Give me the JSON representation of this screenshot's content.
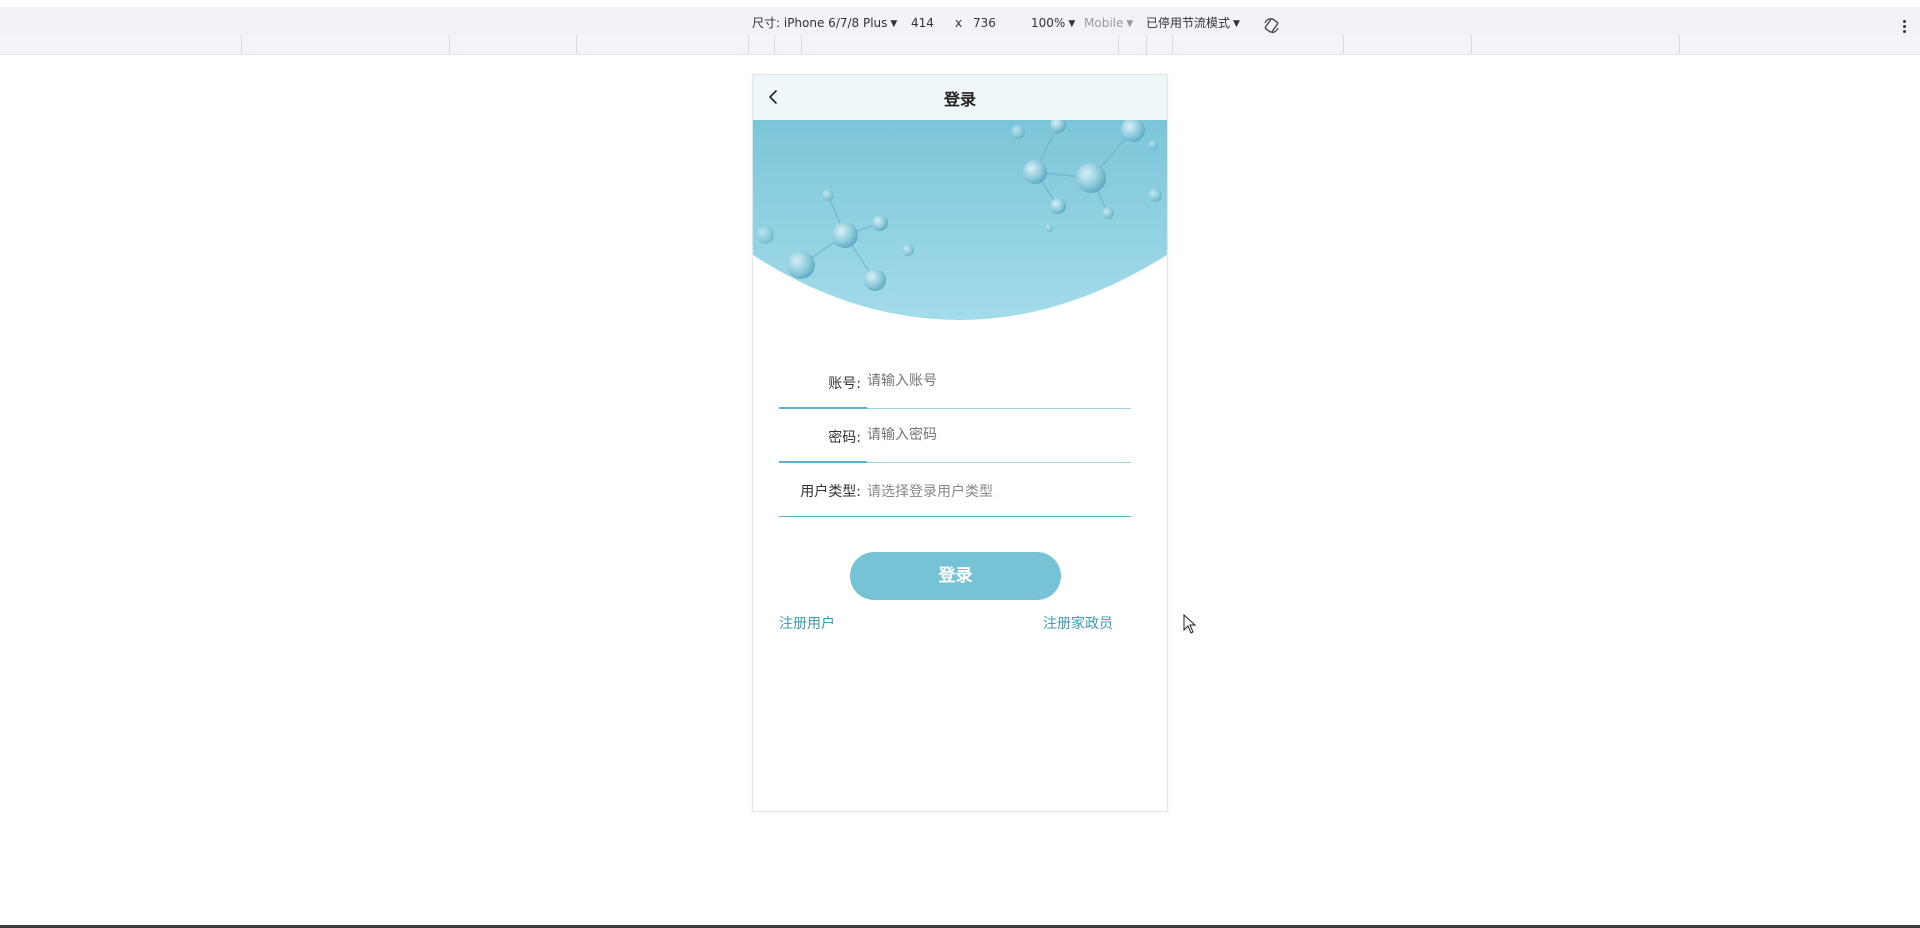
{
  "devtools": {
    "device_label": "尺寸: iPhone 6/7/8 Plus",
    "width": "414",
    "times": "x",
    "height": "736",
    "zoom": "100%",
    "mode": "Mobile",
    "throttle": "已停用节流模式"
  },
  "navbar": {
    "title": "登录"
  },
  "form": {
    "account": {
      "label": "账号:",
      "placeholder": "请输入账号"
    },
    "password": {
      "label": "密码:",
      "placeholder": "请输入密码"
    },
    "user_type": {
      "label": "用户类型:",
      "placeholder": "请选择登录用户类型"
    }
  },
  "login_button": "登录",
  "links": {
    "register_user": "注册用户",
    "register_housekeeper": "注册家政员"
  },
  "colors": {
    "accent": "#76c3d6",
    "link": "#3b9bb3",
    "banner_top": "#7cc5d9",
    "banner_bottom": "#a3dcea"
  }
}
